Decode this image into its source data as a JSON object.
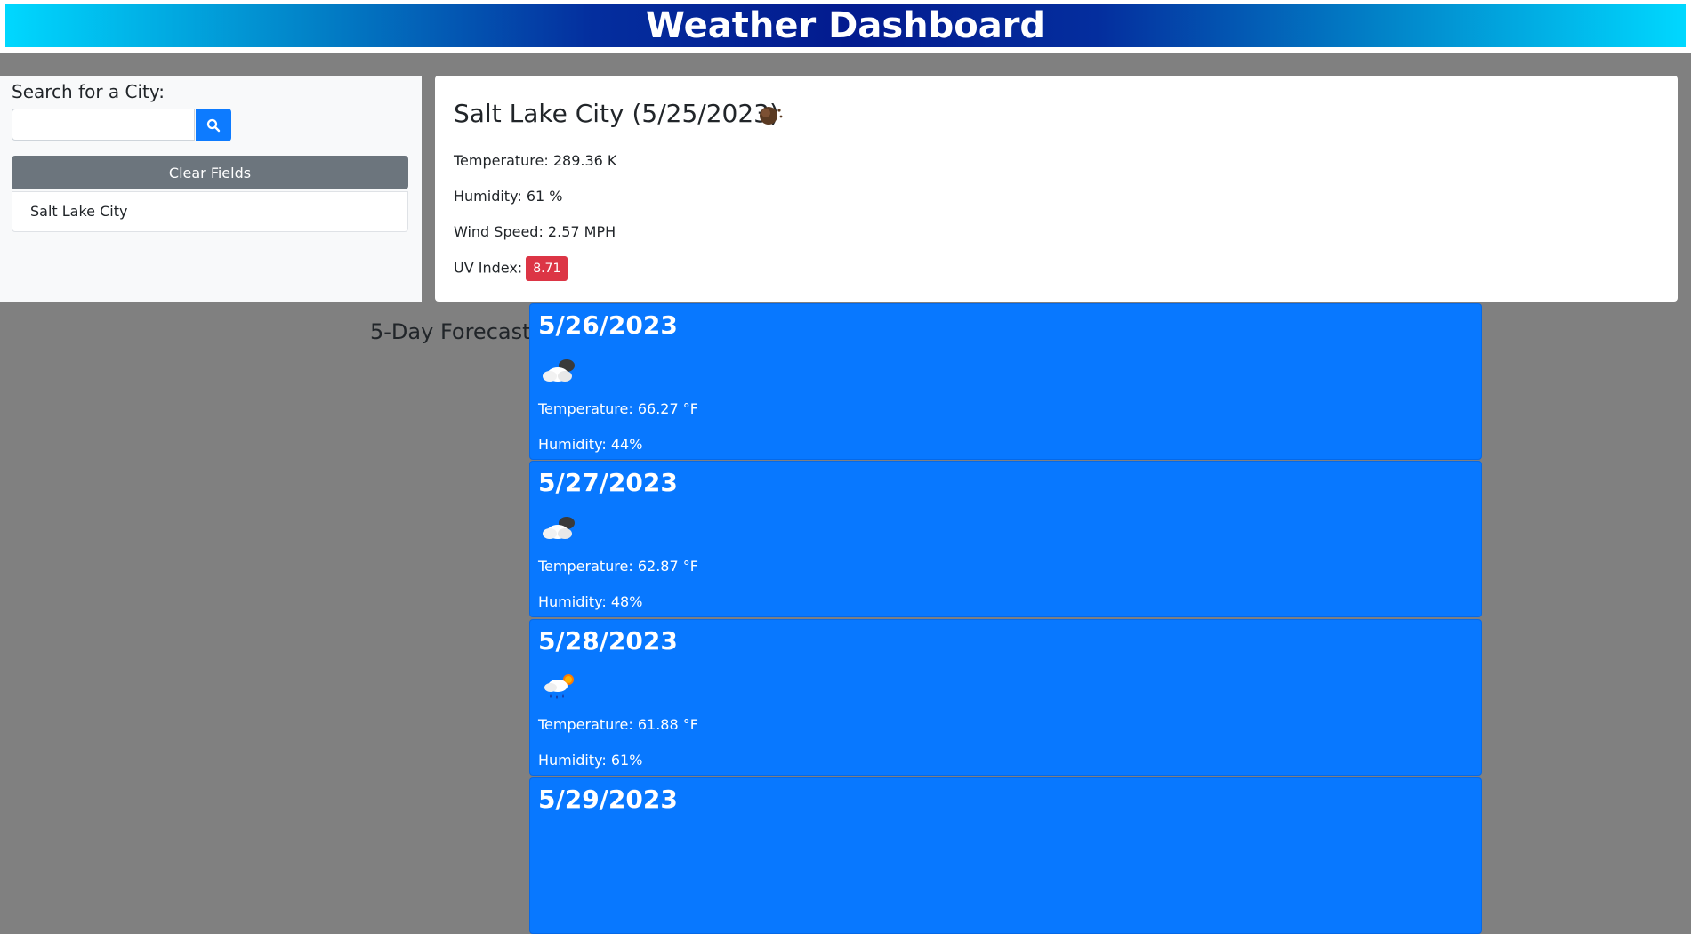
{
  "header": {
    "title": "Weather Dashboard"
  },
  "search": {
    "label": "Search for a City:",
    "value": "",
    "placeholder": "",
    "button_icon": "search-icon",
    "clear_label": "Clear Fields",
    "history": [
      "Salt Lake City"
    ]
  },
  "current": {
    "title": "Salt Lake City (5/25/2023)",
    "icon": "night-moon-icon",
    "temperature": "Temperature: 289.36 K",
    "humidity": "Humidity: 61 %",
    "wind": "Wind Speed: 2.57 MPH",
    "uv_label": "UV Index:",
    "uv_value": "8.71",
    "uv_color": "#dc3545"
  },
  "forecast": {
    "label": "5-Day Forecast:",
    "card_color": "#0878ff",
    "days": [
      {
        "date": "5/26/2023",
        "icon": "cloudy-night-icon",
        "temp": "Temperature: 66.27 °F",
        "humidity": "Humidity: 44%"
      },
      {
        "date": "5/27/2023",
        "icon": "cloudy-night-icon",
        "temp": "Temperature: 62.87 °F",
        "humidity": "Humidity: 48%"
      },
      {
        "date": "5/28/2023",
        "icon": "rain-sun-icon",
        "temp": "Temperature: 61.88 °F",
        "humidity": "Humidity: 61%"
      },
      {
        "date": "5/29/2023",
        "icon": "cloudy-night-icon",
        "temp": "",
        "humidity": ""
      }
    ]
  }
}
